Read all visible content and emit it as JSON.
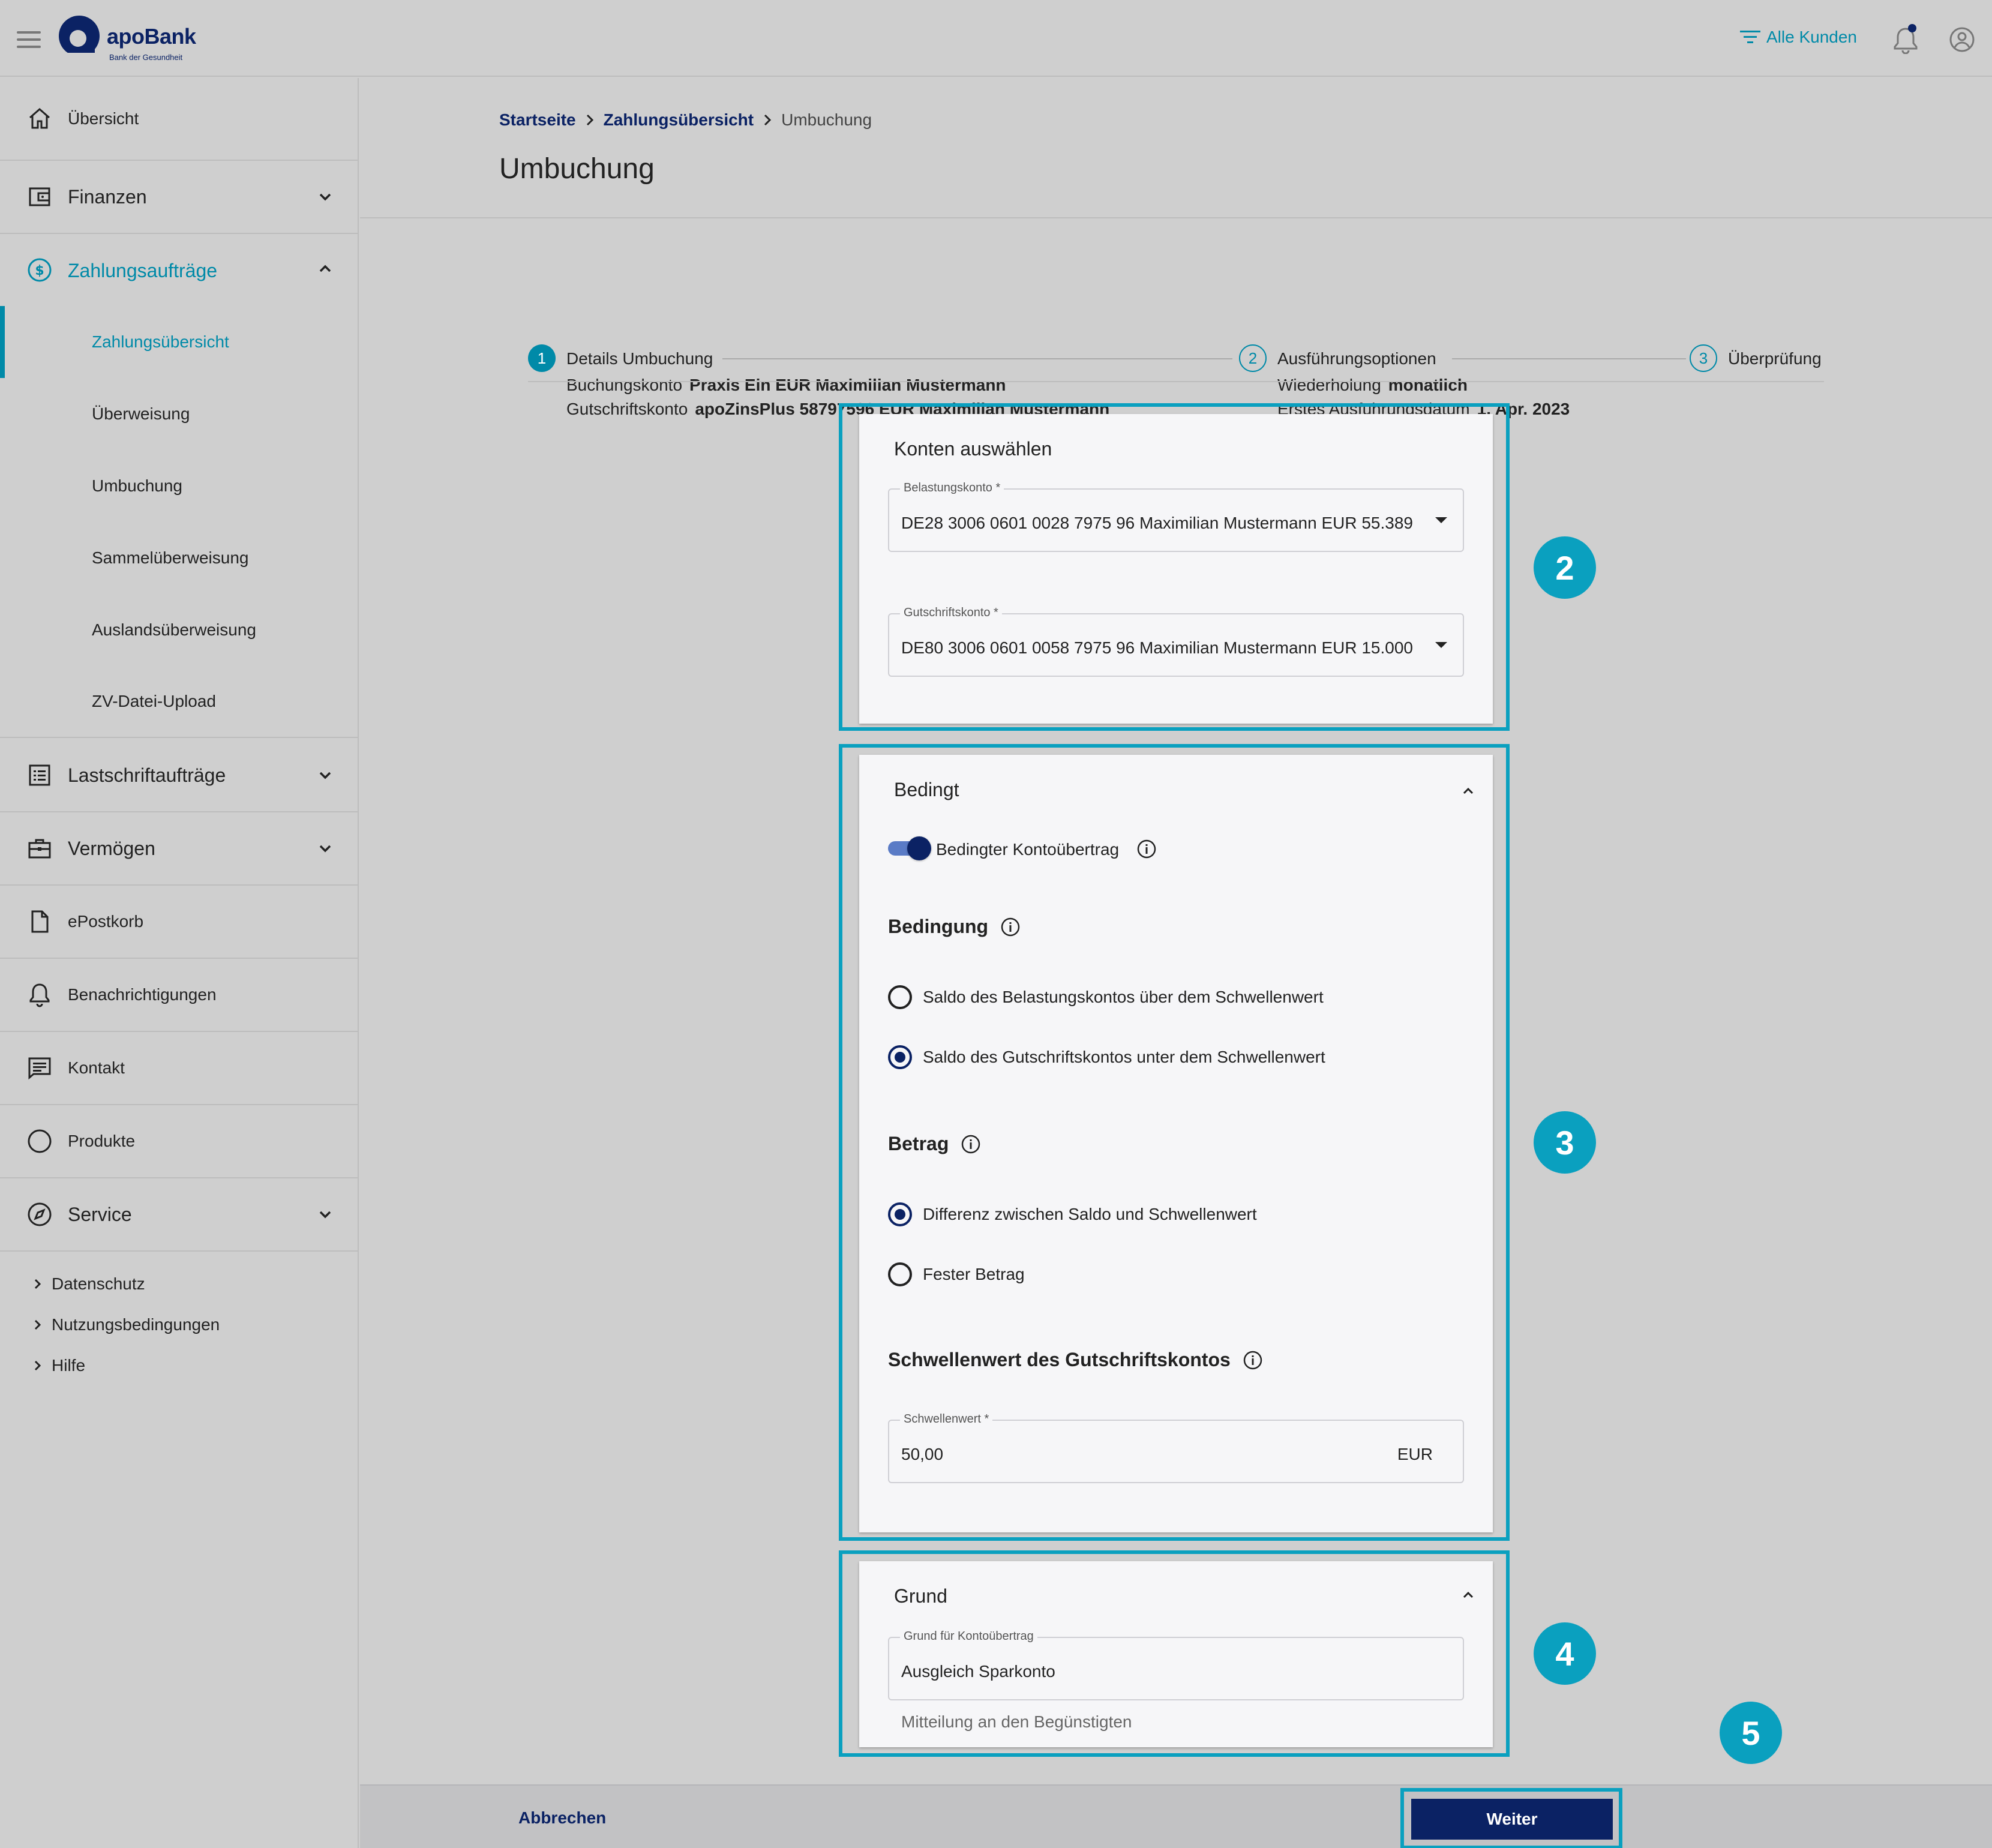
{
  "header": {
    "logo_text": "apoBank",
    "logo_subtitle": "Bank der Gesundheit",
    "filter_label": "Alle Kunden",
    "icons": [
      "menu-icon",
      "filter-icon",
      "bell-icon",
      "user-icon"
    ]
  },
  "sidebar": {
    "items": [
      {
        "label": "Übersicht",
        "icon": "home-icon"
      },
      {
        "label": "Finanzen",
        "icon": "wallet-icon"
      },
      {
        "label": "Zahlungsaufträge",
        "icon": "dollar-circle-icon"
      },
      {
        "label": "Lastschriftaufträge",
        "icon": "list-icon"
      },
      {
        "label": "Vermögen",
        "icon": "briefcase-icon"
      },
      {
        "label": "ePostkorb",
        "icon": "document-icon"
      },
      {
        "label": "Benachrichtigungen",
        "icon": "bell-icon"
      },
      {
        "label": "Kontakt",
        "icon": "chat-icon"
      },
      {
        "label": "Produkte",
        "icon": "circle-icon"
      },
      {
        "label": "Service",
        "icon": "compass-icon"
      }
    ],
    "sub_items": [
      {
        "label": "Zahlungsübersicht"
      },
      {
        "label": "Überweisung"
      },
      {
        "label": "Umbuchung"
      },
      {
        "label": "Sammelüberweisung"
      },
      {
        "label": "Auslandsüberweisung"
      },
      {
        "label": "ZV-Datei-Upload"
      }
    ],
    "footer_links": [
      {
        "label": "Datenschutz"
      },
      {
        "label": "Nutzungsbedingungen"
      },
      {
        "label": "Hilfe"
      }
    ],
    "active_color": "#008aa8"
  },
  "breadcrumb": {
    "home": "Startseite",
    "parent": "Zahlungsübersicht",
    "current": "Umbuchung"
  },
  "page_title": "Umbuchung",
  "stepper": {
    "steps": [
      {
        "number": "1",
        "title": "Details Umbuchung"
      },
      {
        "number": "2",
        "title": "Ausführungsoptionen"
      },
      {
        "number": "3",
        "title": "Überprüfung"
      }
    ],
    "details1": {
      "line1_label": "Buchungskonto",
      "line1_value": "Praxis Ein EUR Maximilian Mustermann",
      "line2_label": "Gutschriftskonto",
      "line2_value": "apoZinsPlus 58797596 EUR Maximilian Mustermann"
    },
    "details2": {
      "line1_label": "Wiederholung",
      "line1_value": "monatlich",
      "line2_label": "Erstes Ausführungsdatum",
      "line2_value": "1. Apr. 2023"
    }
  },
  "konten": {
    "title": "Konten auswählen",
    "belastung_label": "Belastungskonto *",
    "belastung_value": "DE28 3006 0601 0028 7975 96 Maximilian Mustermann EUR 55.389",
    "gutschrift_label": "Gutschriftskonto *",
    "gutschrift_value": "DE80 3006 0601 0058 7975 96 Maximilian Mustermann EUR 15.000"
  },
  "bedingt": {
    "title": "Bedingt",
    "toggle_label": "Bedingter Kontoübertrag",
    "toggle_on": true,
    "bedingung_heading": "Bedingung",
    "bedingung_options": [
      {
        "label": "Saldo des Belastungskontos über dem Schwellenwert",
        "selected": false
      },
      {
        "label": "Saldo des Gutschriftskontos unter dem Schwellenwert",
        "selected": true
      }
    ],
    "betrag_heading": "Betrag",
    "betrag_options": [
      {
        "label": "Differenz zwischen Saldo und Schwellenwert",
        "selected": true
      },
      {
        "label": "Fester Betrag",
        "selected": false
      }
    ],
    "schwellenwert_heading": "Schwellenwert des Gutschriftskontos",
    "schwellenwert_label": "Schwellenwert *",
    "schwellenwert_value": "50,00",
    "schwellenwert_unit": "EUR"
  },
  "grund": {
    "title": "Grund",
    "field_label": "Grund für Kontoübertrag",
    "field_value": "Ausgleich Sparkonto",
    "hint": "Mitteilung an den Begünstigten"
  },
  "badges": [
    "2",
    "3",
    "4",
    "5"
  ],
  "footer": {
    "cancel_label": "Abbrechen",
    "next_label": "Weiter"
  },
  "colors": {
    "primary": "#0b2264",
    "accent": "#008aa8",
    "highlight": "#0aa0bf"
  }
}
